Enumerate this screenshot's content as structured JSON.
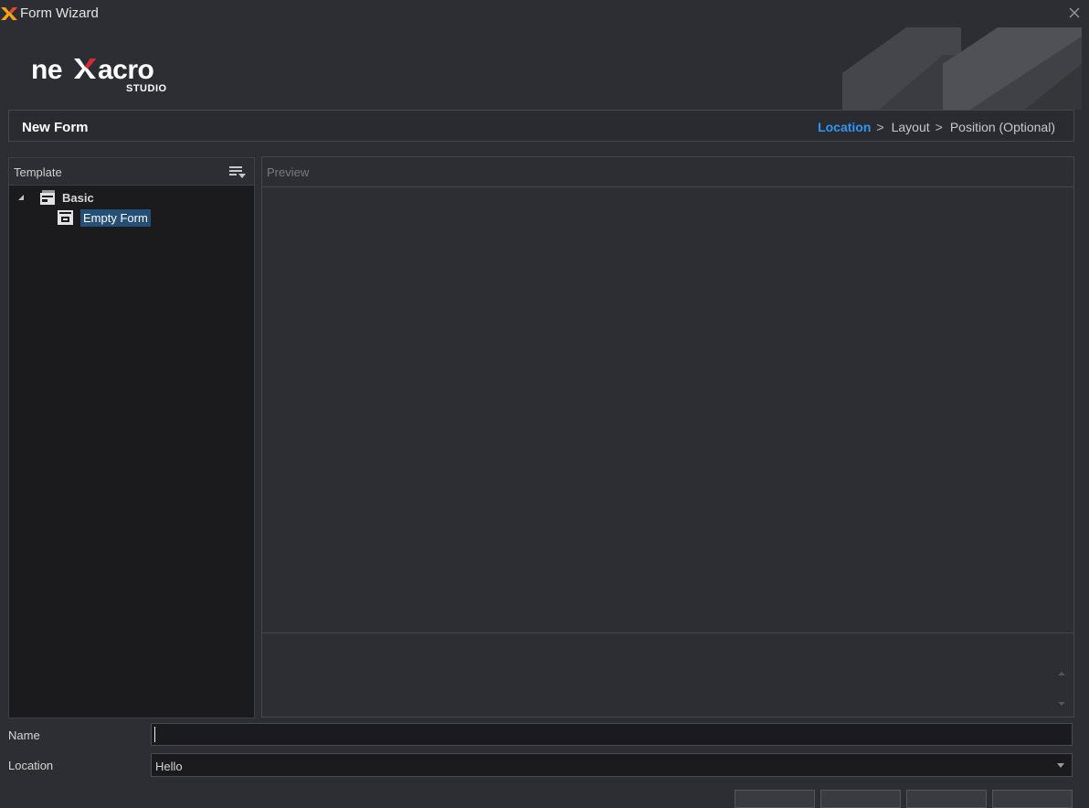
{
  "window": {
    "title": "Form Wizard"
  },
  "brand": {
    "logo_text": "nexacro",
    "logo_subtext": "STUDIO"
  },
  "header": {
    "title": "New Form",
    "steps": [
      {
        "label": "Location",
        "active": true
      },
      {
        "label": "Layout",
        "active": false
      },
      {
        "label": "Position (Optional)",
        "active": false
      }
    ],
    "step_separator": ">"
  },
  "template_panel": {
    "label": "Template",
    "tree": [
      {
        "label": "Basic",
        "expanded": true,
        "children": [
          {
            "label": "Empty Form",
            "selected": true
          }
        ]
      }
    ]
  },
  "preview_panel": {
    "label": "Preview"
  },
  "form": {
    "name_label": "Name",
    "name_value": "",
    "location_label": "Location",
    "location_value": "Hello"
  },
  "colors": {
    "background": "#2d2e33",
    "panel": "#1b1b1d",
    "accent": "#2f96f3",
    "selection": "#264f78"
  },
  "icons": {
    "app": "nexacro-x-icon",
    "close": "close-icon",
    "sort": "sort-list-icon",
    "tree_group": "form-group-icon",
    "tree_item": "form-icon",
    "expand": "expand-triangle-icon",
    "dropdown": "chevron-down-icon"
  }
}
